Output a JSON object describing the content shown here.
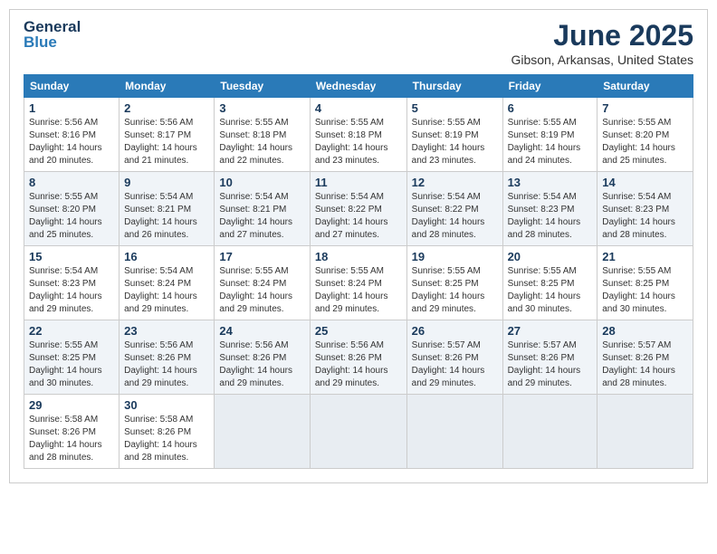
{
  "logo": {
    "line1": "General",
    "line2": "Blue"
  },
  "title": "June 2025",
  "location": "Gibson, Arkansas, United States",
  "weekdays": [
    "Sunday",
    "Monday",
    "Tuesday",
    "Wednesday",
    "Thursday",
    "Friday",
    "Saturday"
  ],
  "weeks": [
    [
      {
        "day": "1",
        "sunrise": "5:56 AM",
        "sunset": "8:16 PM",
        "daylight": "14 hours and 20 minutes."
      },
      {
        "day": "2",
        "sunrise": "5:56 AM",
        "sunset": "8:17 PM",
        "daylight": "14 hours and 21 minutes."
      },
      {
        "day": "3",
        "sunrise": "5:55 AM",
        "sunset": "8:18 PM",
        "daylight": "14 hours and 22 minutes."
      },
      {
        "day": "4",
        "sunrise": "5:55 AM",
        "sunset": "8:18 PM",
        "daylight": "14 hours and 23 minutes."
      },
      {
        "day": "5",
        "sunrise": "5:55 AM",
        "sunset": "8:19 PM",
        "daylight": "14 hours and 23 minutes."
      },
      {
        "day": "6",
        "sunrise": "5:55 AM",
        "sunset": "8:19 PM",
        "daylight": "14 hours and 24 minutes."
      },
      {
        "day": "7",
        "sunrise": "5:55 AM",
        "sunset": "8:20 PM",
        "daylight": "14 hours and 25 minutes."
      }
    ],
    [
      {
        "day": "8",
        "sunrise": "5:55 AM",
        "sunset": "8:20 PM",
        "daylight": "14 hours and 25 minutes."
      },
      {
        "day": "9",
        "sunrise": "5:54 AM",
        "sunset": "8:21 PM",
        "daylight": "14 hours and 26 minutes."
      },
      {
        "day": "10",
        "sunrise": "5:54 AM",
        "sunset": "8:21 PM",
        "daylight": "14 hours and 27 minutes."
      },
      {
        "day": "11",
        "sunrise": "5:54 AM",
        "sunset": "8:22 PM",
        "daylight": "14 hours and 27 minutes."
      },
      {
        "day": "12",
        "sunrise": "5:54 AM",
        "sunset": "8:22 PM",
        "daylight": "14 hours and 28 minutes."
      },
      {
        "day": "13",
        "sunrise": "5:54 AM",
        "sunset": "8:23 PM",
        "daylight": "14 hours and 28 minutes."
      },
      {
        "day": "14",
        "sunrise": "5:54 AM",
        "sunset": "8:23 PM",
        "daylight": "14 hours and 28 minutes."
      }
    ],
    [
      {
        "day": "15",
        "sunrise": "5:54 AM",
        "sunset": "8:23 PM",
        "daylight": "14 hours and 29 minutes."
      },
      {
        "day": "16",
        "sunrise": "5:54 AM",
        "sunset": "8:24 PM",
        "daylight": "14 hours and 29 minutes."
      },
      {
        "day": "17",
        "sunrise": "5:55 AM",
        "sunset": "8:24 PM",
        "daylight": "14 hours and 29 minutes."
      },
      {
        "day": "18",
        "sunrise": "5:55 AM",
        "sunset": "8:24 PM",
        "daylight": "14 hours and 29 minutes."
      },
      {
        "day": "19",
        "sunrise": "5:55 AM",
        "sunset": "8:25 PM",
        "daylight": "14 hours and 29 minutes."
      },
      {
        "day": "20",
        "sunrise": "5:55 AM",
        "sunset": "8:25 PM",
        "daylight": "14 hours and 30 minutes."
      },
      {
        "day": "21",
        "sunrise": "5:55 AM",
        "sunset": "8:25 PM",
        "daylight": "14 hours and 30 minutes."
      }
    ],
    [
      {
        "day": "22",
        "sunrise": "5:55 AM",
        "sunset": "8:25 PM",
        "daylight": "14 hours and 30 minutes."
      },
      {
        "day": "23",
        "sunrise": "5:56 AM",
        "sunset": "8:26 PM",
        "daylight": "14 hours and 29 minutes."
      },
      {
        "day": "24",
        "sunrise": "5:56 AM",
        "sunset": "8:26 PM",
        "daylight": "14 hours and 29 minutes."
      },
      {
        "day": "25",
        "sunrise": "5:56 AM",
        "sunset": "8:26 PM",
        "daylight": "14 hours and 29 minutes."
      },
      {
        "day": "26",
        "sunrise": "5:57 AM",
        "sunset": "8:26 PM",
        "daylight": "14 hours and 29 minutes."
      },
      {
        "day": "27",
        "sunrise": "5:57 AM",
        "sunset": "8:26 PM",
        "daylight": "14 hours and 29 minutes."
      },
      {
        "day": "28",
        "sunrise": "5:57 AM",
        "sunset": "8:26 PM",
        "daylight": "14 hours and 28 minutes."
      }
    ],
    [
      {
        "day": "29",
        "sunrise": "5:58 AM",
        "sunset": "8:26 PM",
        "daylight": "14 hours and 28 minutes."
      },
      {
        "day": "30",
        "sunrise": "5:58 AM",
        "sunset": "8:26 PM",
        "daylight": "14 hours and 28 minutes."
      },
      null,
      null,
      null,
      null,
      null
    ]
  ],
  "labels": {
    "sunrise": "Sunrise:",
    "sunset": "Sunset:",
    "daylight": "Daylight:"
  }
}
